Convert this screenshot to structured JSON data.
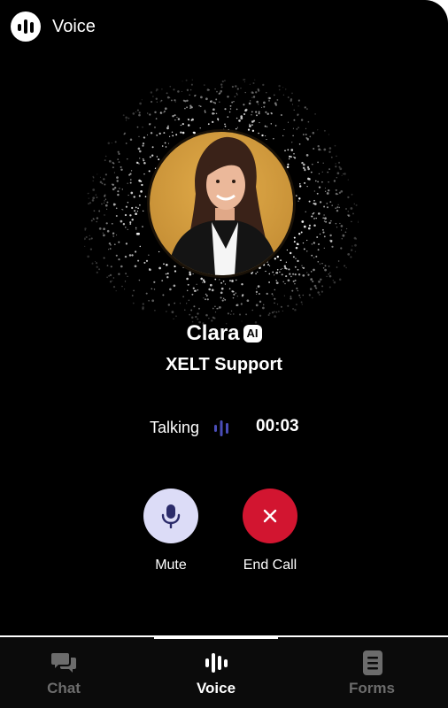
{
  "header": {
    "title": "Voice",
    "logo_icon": "voice-wave-icon"
  },
  "agent": {
    "name": "Clara",
    "badge": "AI",
    "organization": "XELT Support",
    "avatar_icon": "agent-avatar"
  },
  "call": {
    "status": "Talking",
    "timer": "00:03"
  },
  "controls": {
    "mute_label": "Mute",
    "end_label": "End Call"
  },
  "nav": {
    "items": [
      {
        "label": "Chat",
        "icon": "chat-bubbles-icon",
        "active": false
      },
      {
        "label": "Voice",
        "icon": "voice-wave-icon",
        "active": true
      },
      {
        "label": "Forms",
        "icon": "form-document-icon",
        "active": false
      }
    ]
  },
  "colors": {
    "background": "#000000",
    "mute_button": "#dcdcf7",
    "end_button": "#d21530",
    "status_wave": "#4a4db8",
    "inactive_nav": "#6c6c6c"
  }
}
